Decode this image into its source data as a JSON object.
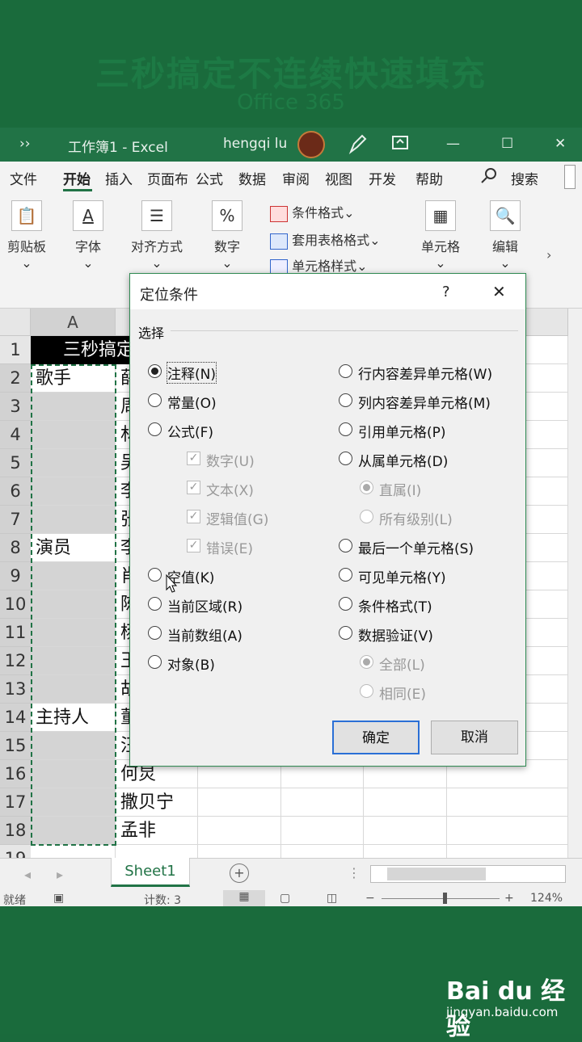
{
  "banner": {
    "title": "三秒搞定不连续快速填充",
    "subtitle": "Office 365"
  },
  "titlebar": {
    "chevron": "››",
    "doc": "工作簿1  -  Excel",
    "user": "hengqi lu",
    "minimize": "—",
    "maximize": "☐",
    "close": "✕"
  },
  "ribbon_tabs": [
    "文件",
    "开始",
    "插入",
    "页面布",
    "公式",
    "数据",
    "审阅",
    "视图",
    "开发",
    "帮助"
  ],
  "search_label": "搜索",
  "ribbon": {
    "clipboard": "剪贴板",
    "font": "字体",
    "align": "对齐方式",
    "number": "数字",
    "cond_format": "条件格式",
    "table_format": "套用表格格式",
    "cell_style": "单元格样式",
    "cells": "单元格",
    "edit": "编辑",
    "caret": "⌄"
  },
  "sheet": {
    "col_a": "A",
    "rows": [
      "1",
      "2",
      "3",
      "4",
      "5",
      "6",
      "7",
      "8",
      "9",
      "10",
      "11",
      "12",
      "13",
      "14",
      "15",
      "16",
      "17",
      "18",
      "19"
    ],
    "r1_title": "三秒搞定",
    "colA": {
      "r2": "歌手",
      "r8": "演员",
      "r14": "主持人"
    },
    "colB": [
      "薛",
      "周",
      "林",
      "吴",
      "李",
      "张",
      "李",
      "肖",
      "陈",
      "杨",
      "王",
      "胡",
      "董",
      "汪",
      "何炅",
      "撒贝宁",
      "孟非"
    ]
  },
  "sheet_tab": "Sheet1",
  "status": {
    "ready": "就绪",
    "count": "计数: 3",
    "zoom": "124%"
  },
  "dialog": {
    "title": "定位条件",
    "help": "?",
    "close": "✕",
    "group": "选择",
    "left": [
      {
        "label": "注释(N)",
        "state": "on"
      },
      {
        "label": "常量(O)",
        "state": "off"
      },
      {
        "label": "公式(F)",
        "state": "off"
      },
      {
        "label": "数字(U)",
        "state": "chk"
      },
      {
        "label": "文本(X)",
        "state": "chk"
      },
      {
        "label": "逻辑值(G)",
        "state": "chk"
      },
      {
        "label": "错误(E)",
        "state": "chk"
      },
      {
        "label": "空值(K)",
        "state": "off"
      },
      {
        "label": "当前区域(R)",
        "state": "off"
      },
      {
        "label": "当前数组(A)",
        "state": "off"
      },
      {
        "label": "对象(B)",
        "state": "off"
      }
    ],
    "right": [
      {
        "label": "行内容差异单元格(W)",
        "state": "off"
      },
      {
        "label": "列内容差异单元格(M)",
        "state": "off"
      },
      {
        "label": "引用单元格(P)",
        "state": "off"
      },
      {
        "label": "从属单元格(D)",
        "state": "off"
      },
      {
        "label": "直属(I)",
        "state": "dison"
      },
      {
        "label": "所有级别(L)",
        "state": "dis"
      },
      {
        "label": "最后一个单元格(S)",
        "state": "off"
      },
      {
        "label": "可见单元格(Y)",
        "state": "off"
      },
      {
        "label": "条件格式(T)",
        "state": "off"
      },
      {
        "label": "数据验证(V)",
        "state": "off"
      },
      {
        "label": "全部(L)",
        "state": "dison"
      },
      {
        "label": "相同(E)",
        "state": "dis"
      }
    ],
    "ok": "确定",
    "cancel": "取消"
  },
  "watermark": {
    "brand": "Bai du 经验",
    "url": "jingyan.baidu.com"
  }
}
